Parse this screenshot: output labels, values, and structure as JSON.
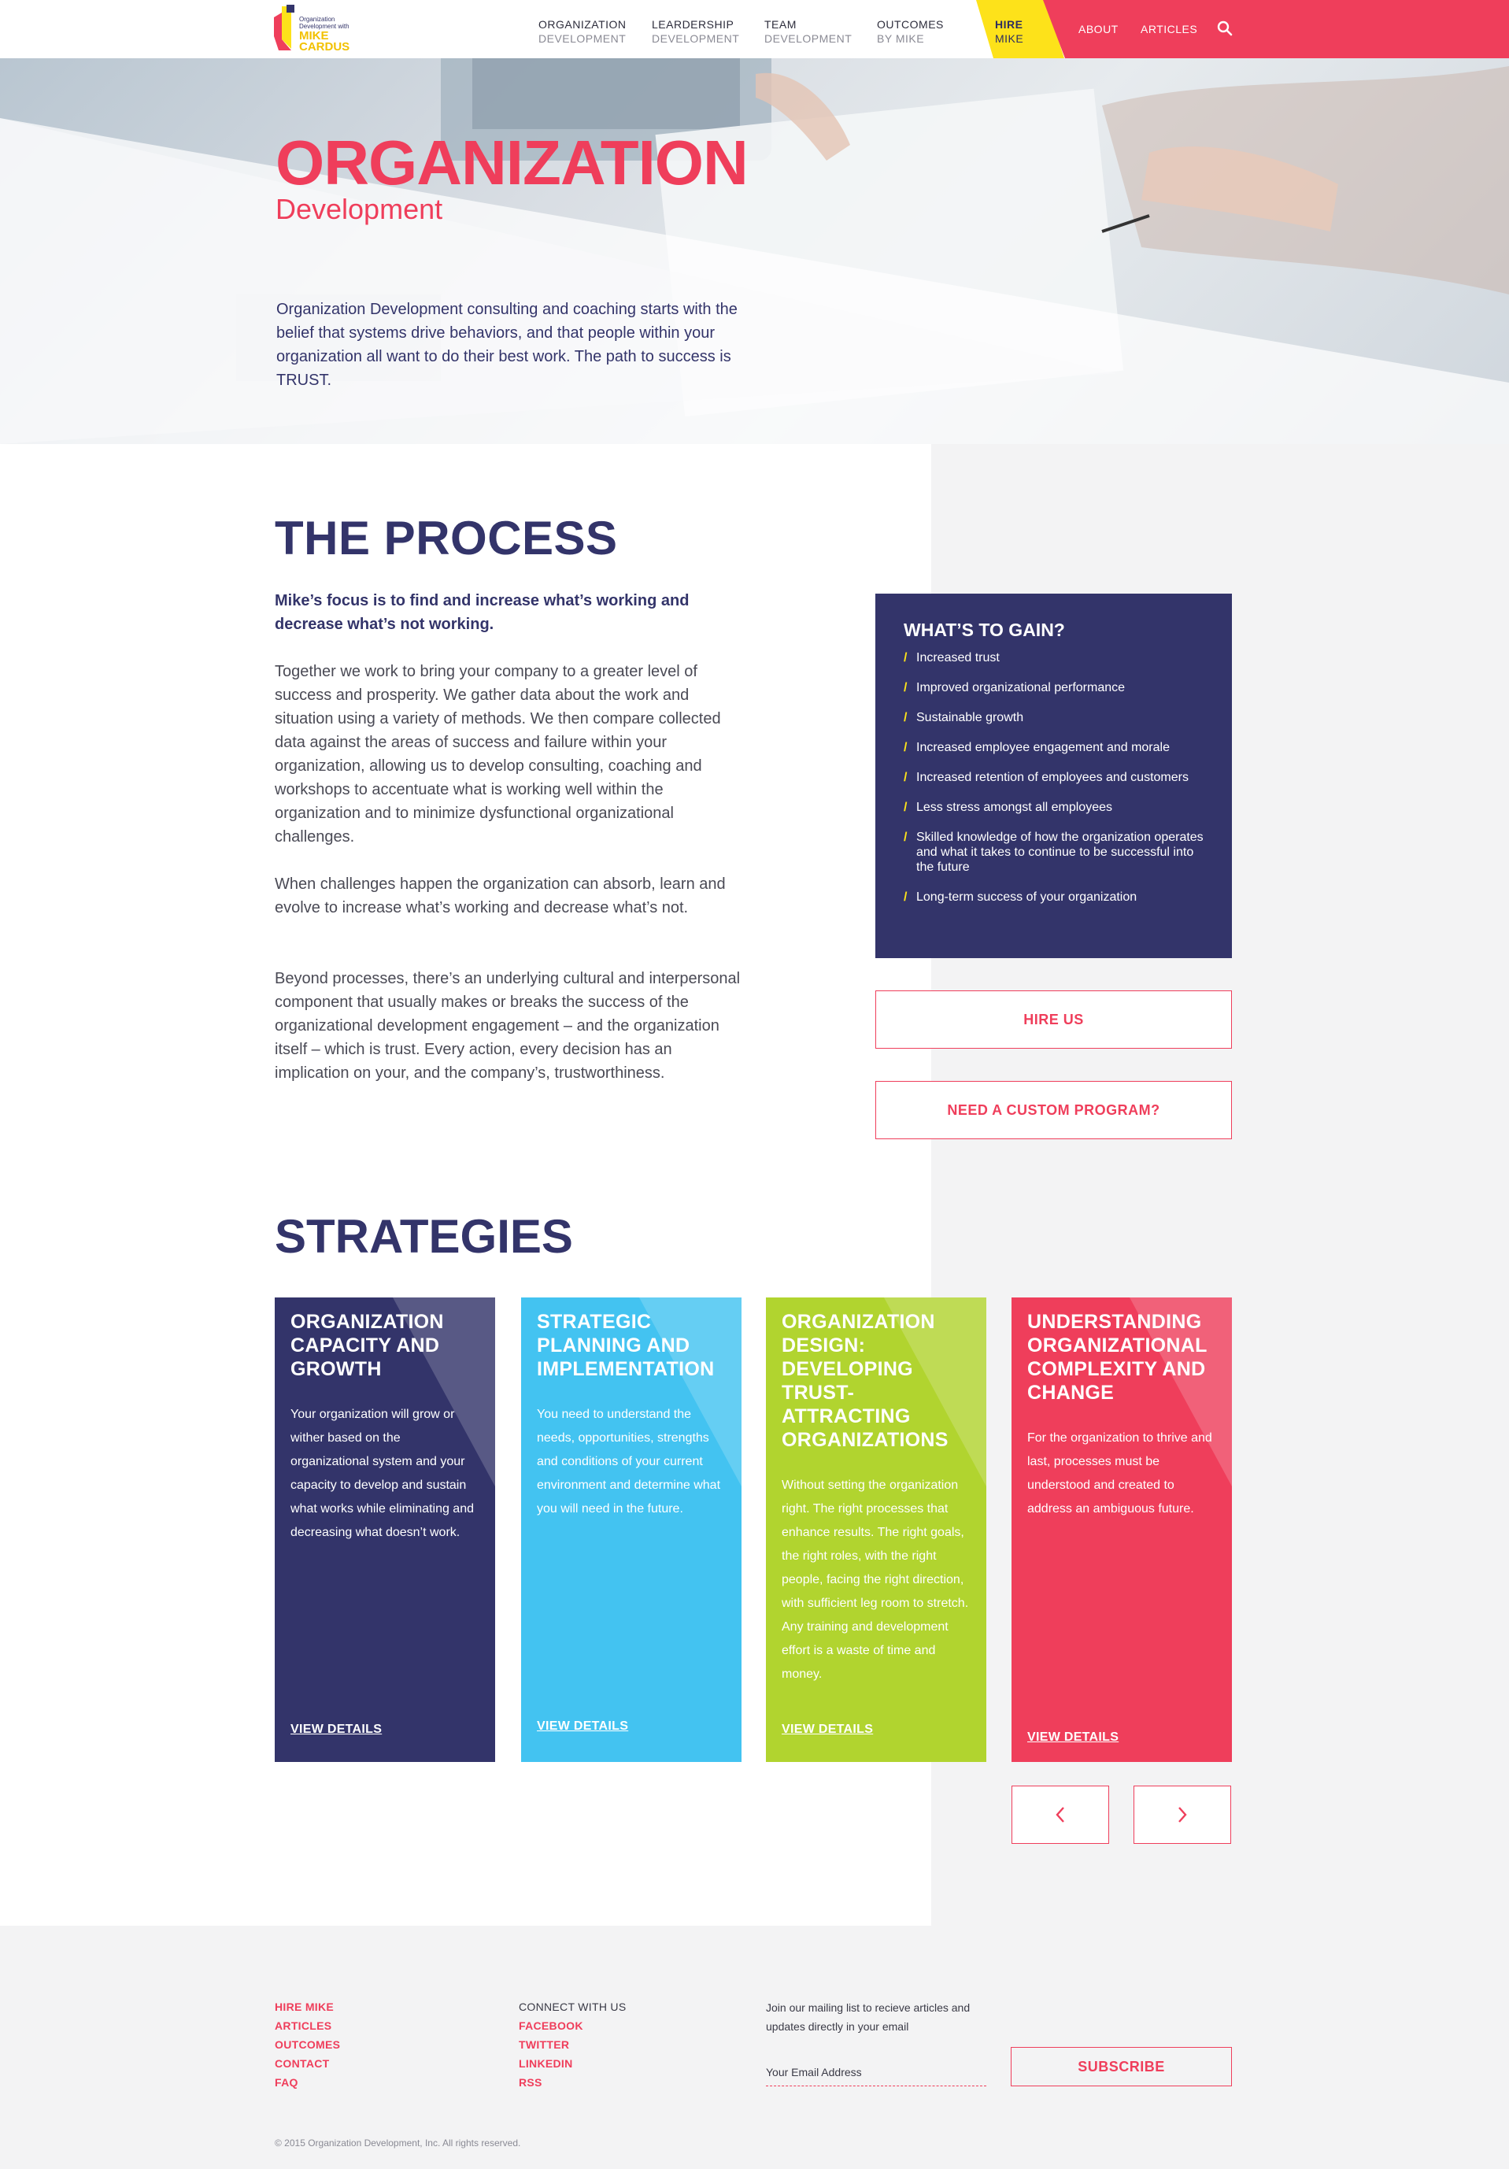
{
  "brand": {
    "logo_small": "Organization Development with",
    "logo_name": "MIKE CARDUS",
    "accent_pink": "#ef3e5b",
    "navy": "#33346a",
    "yellow": "#fde21a"
  },
  "nav": {
    "items": [
      {
        "line1": "ORGANIZATION",
        "line2": "DEVELOPMENT"
      },
      {
        "line1": "LEARDERSHIP",
        "line2": "DEVELOPMENT"
      },
      {
        "line1": "TEAM",
        "line2": "DEVELOPMENT"
      },
      {
        "line1": "OUTCOMES",
        "line2": "BY MIKE"
      }
    ],
    "hire": {
      "line1": "HIRE",
      "line2": "MIKE"
    },
    "about": "ABOUT",
    "articles": "ARTICLES",
    "search_icon": "search-icon"
  },
  "hero": {
    "title": "ORGANIZATION",
    "subtitle": "Development",
    "text": "Organization Development consulting and coaching starts with the belief that systems drive behaviors, and that people within your organization all want to do their best work. The path to success is TRUST."
  },
  "process": {
    "heading": "THE PROCESS",
    "lead": "Mike’s focus is to find and increase what’s working and decrease what’s not working.",
    "paragraphs": [
      "Together we work to bring your company to a greater level of success and prosperity. We gather data about the work and situation using a variety of methods. We then compare collected data against the areas of success and failure within your organization, allowing us to develop consulting, coaching and workshops to accentuate what is working well within the organization and to minimize dysfunctional organizational challenges.",
      "When challenges happen the organization can absorb, learn and evolve to increase what’s working and decrease what’s not.",
      "Beyond processes, there’s an underlying cultural and interpersonal component that usually makes or breaks the success of the organizational development engagement – and the organization itself – which is trust. Every action, every decision has an implication on your, and the company’s, trustworthiness."
    ]
  },
  "gain": {
    "title": "WHAT’S TO GAIN?",
    "items": [
      "Increased trust",
      "Improved organizational performance",
      "Sustainable growth",
      "Increased employee engagement and morale",
      "Increased retention of employees and customers",
      "Less stress amongst all employees",
      "Skilled knowledge of how the organization operates and what it takes to continue to be successful into the future",
      "Long-term success of your organization"
    ]
  },
  "cta": {
    "hire_us": "HIRE US",
    "custom": "NEED A CUSTOM PROGRAM?"
  },
  "strategies": {
    "heading": "STRATEGIES",
    "cards": [
      {
        "title": "ORGANIZATION CAPACITY AND GROWTH",
        "body": "Your organization will grow or wither based on the organizational system and your capacity to develop and sustain what works while eliminating and decreasing what doesn’t work.",
        "link": "VIEW DETAILS",
        "color": "#33346a"
      },
      {
        "title": "STRATEGIC PLANNING AND IMPLEMENTATION",
        "body": "You need to understand the needs, opportunities, strengths and conditions of your current environment and determine what you will need in the future.",
        "link": "VIEW DETAILS",
        "color": "#43c3f1"
      },
      {
        "title": "ORGANIZATION DESIGN: DEVELOPING TRUST-ATTRACTING ORGANIZATIONS",
        "body": "Without setting the organization right. The right processes that enhance results. The right goals, the right roles, with the right people, facing the right direction, with sufficient leg room to stretch. Any training and development effort is a waste of time and money.",
        "link": "VIEW DETAILS",
        "color": "#b1d42f"
      },
      {
        "title": "UNDERSTANDING ORGANIZATIONAL COMPLEXITY AND CHANGE",
        "body": "For the organization to thrive and last, processes must be understood and created to address an ambiguous future.",
        "link": "VIEW DETAILS",
        "color": "#ef3e5b"
      }
    ],
    "prev_icon": "chevron-left-icon",
    "next_icon": "chevron-right-icon"
  },
  "footer": {
    "links": [
      "HIRE MIKE",
      "ARTICLES",
      "OUTCOMES",
      "CONTACT",
      "FAQ"
    ],
    "connect_heading": "CONNECT WITH US",
    "social": [
      "FACEBOOK",
      "TWITTER",
      "LINKEDIN",
      "RSS"
    ],
    "mailing_text": "Join our mailing list to recieve articles and updates directly in your email",
    "email_placeholder": "Your Email Address",
    "subscribe": "SUBSCRIBE",
    "copyright": "© 2015 Organization Development, Inc. All rights reserved."
  }
}
